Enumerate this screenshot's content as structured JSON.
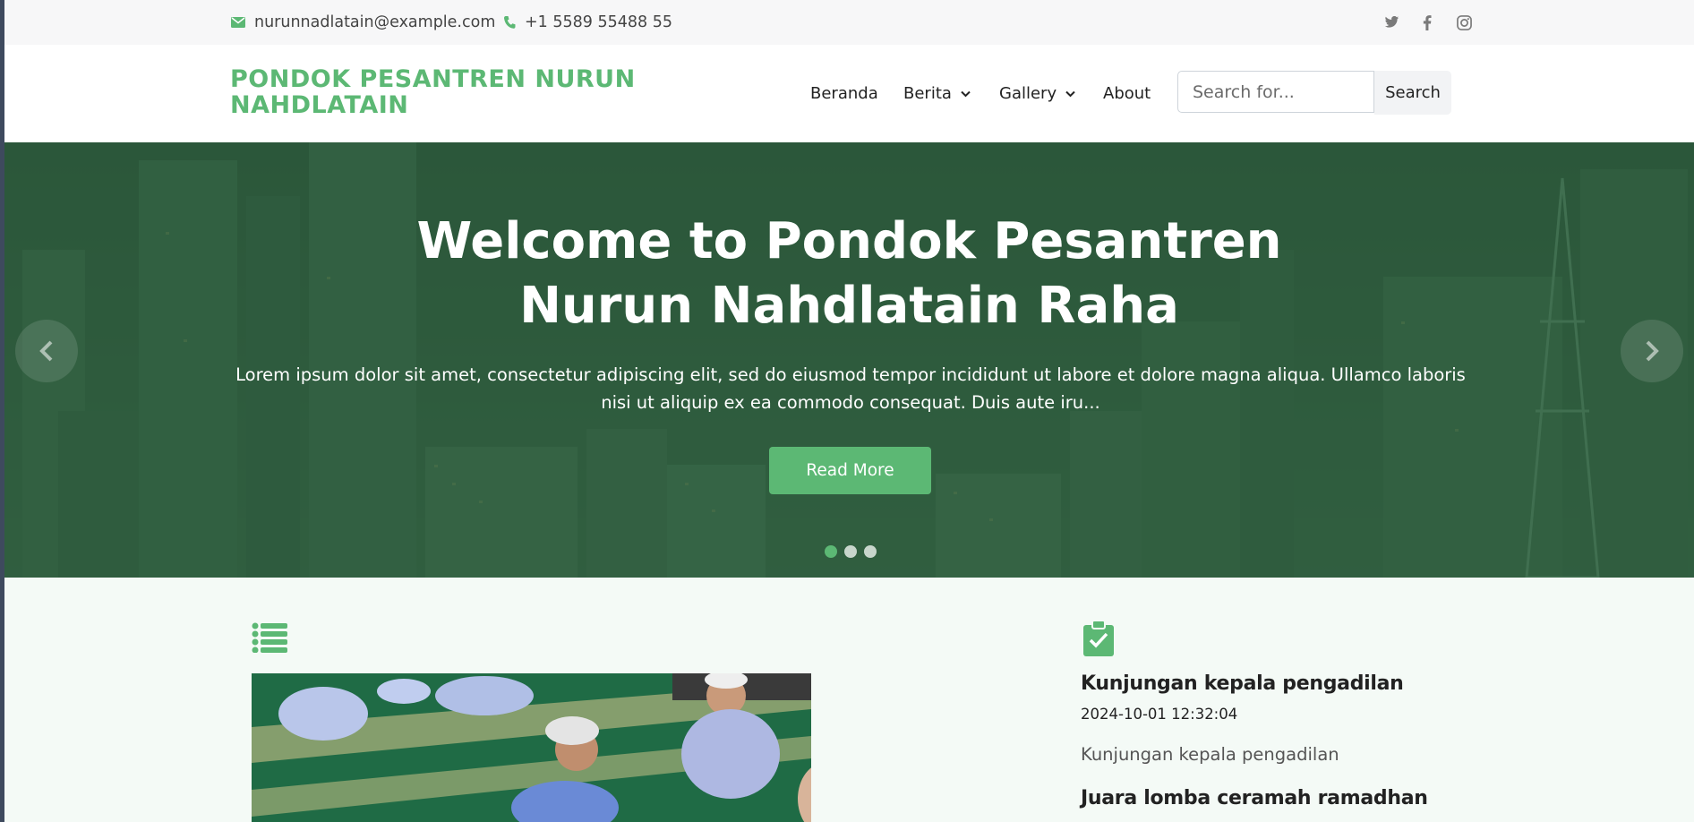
{
  "topbar": {
    "email": "nurunnadlatain@example.com",
    "phone": "+1 5589 55488 55",
    "social": [
      "twitter-icon",
      "facebook-icon",
      "instagram-icon"
    ]
  },
  "header": {
    "logo": "PONDOK PESANTREN NURUN NAHDLATAIN",
    "nav": {
      "home": "Beranda",
      "news": "Berita",
      "gallery": "Gallery",
      "about": "About"
    },
    "search": {
      "placeholder": "Search for...",
      "button": "Search"
    }
  },
  "hero": {
    "title": "Welcome to Pondok Pesantren Nurun Nahdlatain Raha",
    "text": "Lorem ipsum dolor sit amet, consectetur adipiscing elit, sed do eiusmod tempor incididunt ut labore et dolore magna aliqua. Ullamco laboris nisi ut aliquip ex ea commodo consequat. Duis aute iru...",
    "button": "Read More",
    "slides_count": 3,
    "active_slide": 1
  },
  "posts": [
    {
      "title": "Kunjungan kepala pengadilan",
      "date": "2024-10-01 12:32:04",
      "desc": "Kunjungan kepala pengadilan"
    },
    {
      "title": "Juara lomba ceramah ramadhan"
    }
  ],
  "colors": {
    "accent": "#5cb874",
    "hero_overlay": "#2f6240",
    "topbar_bg": "#f7f7f8",
    "content_bg": "#f4faf6"
  }
}
